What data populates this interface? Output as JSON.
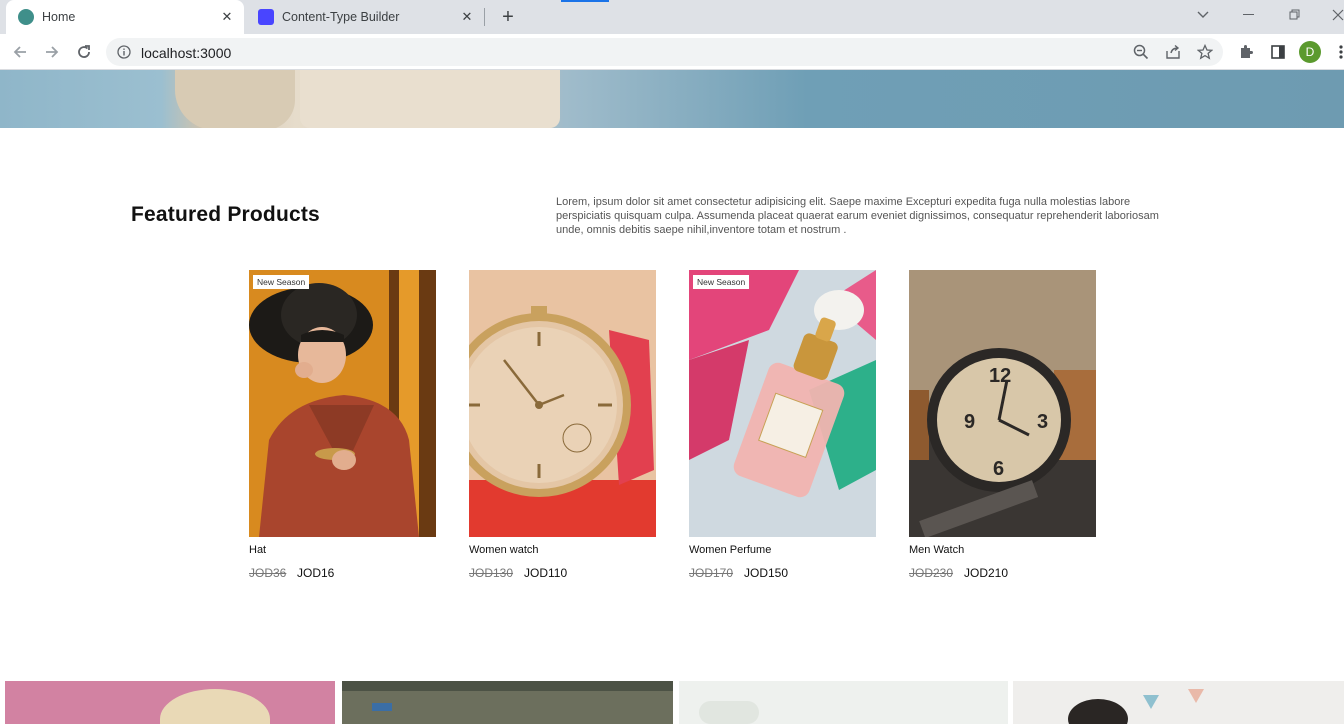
{
  "browser": {
    "tabs": [
      {
        "title": "Home",
        "active": true
      },
      {
        "title": "Content-Type Builder",
        "active": false
      }
    ],
    "url": "localhost:3000",
    "profile_initial": "D"
  },
  "section": {
    "title": "Featured Products",
    "description": "Lorem, ipsum dolor sit amet consectetur adipisicing elit. Saepe maxime Excepturi expedita fuga nulla molestias labore perspiciatis quisquam culpa. Assumenda placeat quaerat earum eveniet dignissimos, consequatur reprehenderit laboriosam unde, omnis debitis saepe nihil,inventore totam et nostrum ."
  },
  "products": [
    {
      "name": "Hat",
      "old_price": "JOD36",
      "price": "JOD16",
      "badge": "New Season"
    },
    {
      "name": "Women watch",
      "old_price": "JOD130",
      "price": "JOD110",
      "badge": ""
    },
    {
      "name": "Women Perfume",
      "old_price": "JOD170",
      "price": "JOD150",
      "badge": "New Season"
    },
    {
      "name": "Men Watch",
      "old_price": "JOD230",
      "price": "JOD210",
      "badge": ""
    }
  ],
  "colors": {
    "accent": "#1a73e8",
    "avatar": "#5b9a2e"
  }
}
